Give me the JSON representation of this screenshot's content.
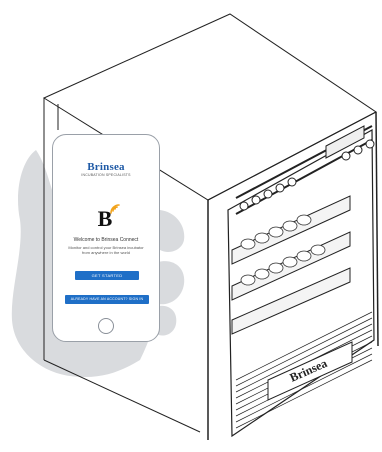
{
  "phone": {
    "brand_name": "Brinsea",
    "brand_tagline": "INCUBATION SPECIALISTS",
    "logo_letter": "B",
    "welcome_title": "Welcome to Brinsea Connect",
    "subtitle": "Monitor and control your Brinsea incubator from anywhere in the world",
    "primary_button": "GET STARTED",
    "secondary_button": "ALREADY HAVE AN ACCOUNT? SIGN IN"
  },
  "incubator": {
    "front_label": "Brinsea"
  },
  "colors": {
    "brand_blue": "#1f6fc7",
    "wifi_orange": "#f2a31b",
    "hand_gray": "#d6d8dc"
  },
  "icons": [
    "wifi-icon",
    "home-button-icon"
  ]
}
